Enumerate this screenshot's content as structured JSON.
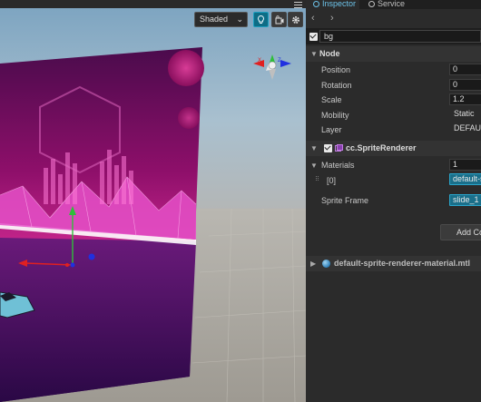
{
  "scene": {
    "shading_mode": "Shaded",
    "gizmo_axes": {
      "x": "X",
      "y": "Y",
      "z": "Z"
    }
  },
  "inspector": {
    "tabs": [
      {
        "label": "Inspector",
        "icon": "inspector-icon",
        "active": true
      },
      {
        "label": "Service",
        "icon": "service-icon",
        "active": false
      }
    ],
    "node_name": "bg",
    "node_section": {
      "title": "Node",
      "properties": [
        {
          "label": "Position",
          "value": "0"
        },
        {
          "label": "Rotation",
          "value": "0"
        },
        {
          "label": "Scale",
          "value": "1.2"
        },
        {
          "label": "Mobility",
          "value": "Static"
        },
        {
          "label": "Layer",
          "value": "DEFAULT"
        }
      ]
    },
    "sprite_renderer": {
      "title": "cc.SpriteRenderer",
      "materials_label": "Materials",
      "materials_count": "1",
      "material_index_label": "[0]",
      "material_value": "default-sprite-renderer-material",
      "sprite_frame_label": "Sprite Frame",
      "sprite_frame_value": "slide_1"
    },
    "add_component_label": "Add Component",
    "material_asset": "default-sprite-renderer-material.mtl"
  },
  "colors": {
    "accent": "#1b9fbf",
    "asset_field": "#1a6f8a",
    "tab_active_text": "#6cc2e8",
    "scene_magenta": "#c2187a"
  }
}
